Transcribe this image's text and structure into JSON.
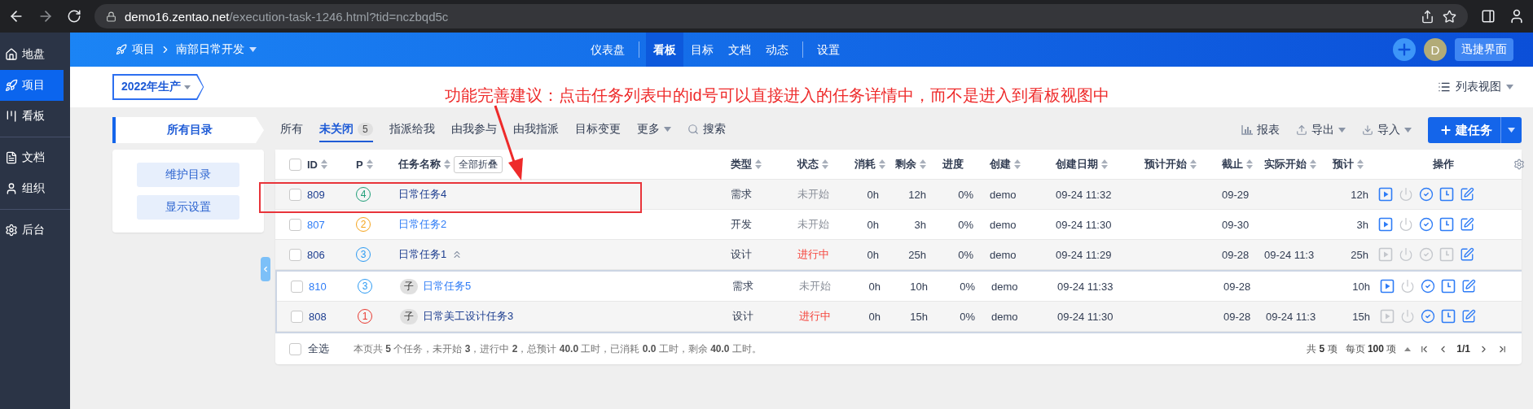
{
  "browser": {
    "domain": "demo16.zentao.net",
    "path": "/execution-task-1246.html?tid=nczbqd5c"
  },
  "sidebar": {
    "groups": [
      [
        {
          "label": "地盘",
          "kind": "home",
          "selected": false
        },
        {
          "label": "项目",
          "kind": "project",
          "selected": true
        },
        {
          "label": "看板",
          "kind": "kanban",
          "selected": false
        }
      ],
      [
        {
          "label": "文档",
          "kind": "doc",
          "selected": false
        },
        {
          "label": "组织",
          "kind": "org",
          "selected": false
        }
      ],
      [
        {
          "label": "后台",
          "kind": "admin",
          "selected": false
        }
      ]
    ]
  },
  "topbar": {
    "breadcrumb": {
      "root": "项目",
      "current": "南部日常开发"
    },
    "nav": [
      [
        {
          "label": "仪表盘",
          "selected": false
        }
      ],
      [
        {
          "label": "看板",
          "selected": true
        },
        {
          "label": "目标",
          "selected": false
        },
        {
          "label": "文档",
          "selected": false
        },
        {
          "label": "动态",
          "selected": false
        }
      ],
      [
        {
          "label": "设置",
          "selected": false
        }
      ]
    ],
    "avatar": "D",
    "quick_button": "迅捷界面"
  },
  "subbar": {
    "execution": "2022年生产",
    "view": "列表视图"
  },
  "annotation": {
    "text": "功能完善建议：点击任务列表中的id号可以直接进入的任务详情中，而不是进入到看板视图中"
  },
  "catalog": {
    "title": "所有目录",
    "buttons": [
      "维护目录",
      "显示设置"
    ]
  },
  "filters": [
    {
      "label": "所有",
      "kind": "tab",
      "selected": false
    },
    {
      "label": "未关闭",
      "kind": "tab",
      "selected": true,
      "count": "5"
    },
    {
      "label": "指派给我",
      "kind": "tab",
      "selected": false
    },
    {
      "label": "由我参与",
      "kind": "tab",
      "selected": false
    },
    {
      "label": "由我指派",
      "kind": "tab",
      "selected": false
    },
    {
      "label": "目标变更",
      "kind": "tab",
      "selected": false
    },
    {
      "label": "更多",
      "kind": "dropdown",
      "selected": false
    },
    {
      "label": "搜索",
      "kind": "search",
      "selected": false
    }
  ],
  "toolbar": [
    {
      "label": "报表",
      "kind": "report"
    },
    {
      "label": "导出",
      "kind": "export"
    },
    {
      "label": "导入",
      "kind": "import"
    }
  ],
  "create_button": "建任务",
  "table": {
    "columns": [
      {
        "label": "ID",
        "sortable": true
      },
      {
        "label": "P",
        "sortable": true
      },
      {
        "label": "任务名称",
        "sortable": true
      },
      {
        "label": "类型",
        "sortable": true
      },
      {
        "label": "状态",
        "sortable": true
      },
      {
        "label": "消耗",
        "sortable": true
      },
      {
        "label": "剩余",
        "sortable": true
      },
      {
        "label": "进度",
        "sortable": false
      },
      {
        "label": "创建",
        "sortable": true
      },
      {
        "label": "创建日期",
        "sortable": true
      },
      {
        "label": "预计开始",
        "sortable": true
      },
      {
        "label": "截止",
        "sortable": true
      },
      {
        "label": "实际开始",
        "sortable": true
      },
      {
        "label": "预计",
        "sortable": true
      },
      {
        "label": "操作",
        "sortable": false
      }
    ],
    "collapse_button": "全部折叠",
    "header_checked": false,
    "rows": [
      {
        "id": "809",
        "checked": false,
        "visited": true,
        "priority": {
          "text": "4",
          "color": "#1e9e78"
        },
        "name": "日常任务4",
        "type": "需求",
        "status": {
          "text": "未开始",
          "kind": "wait"
        },
        "consumed": "0h",
        "left": "12h",
        "progress": "0%",
        "creator": "demo",
        "created": "09-24 11:32",
        "deadline": "09-29",
        "estimate": "12h",
        "actions": [
          {
            "kind": "start",
            "disabled": false
          },
          {
            "kind": "pause",
            "disabled": true
          },
          {
            "kind": "finish",
            "disabled": false
          },
          {
            "kind": "record",
            "disabled": false
          },
          {
            "kind": "edit",
            "disabled": false
          }
        ]
      },
      {
        "id": "807",
        "checked": false,
        "visited": false,
        "priority": {
          "text": "2",
          "color": "#f5a31a"
        },
        "name": "日常任务2",
        "type": "开发",
        "status": {
          "text": "未开始",
          "kind": "wait"
        },
        "consumed": "0h",
        "left": "3h",
        "progress": "0%",
        "creator": "demo",
        "created": "09-24 11:30",
        "deadline": "09-30",
        "estimate": "3h",
        "actions": [
          {
            "kind": "start",
            "disabled": false
          },
          {
            "kind": "pause",
            "disabled": true
          },
          {
            "kind": "finish",
            "disabled": false
          },
          {
            "kind": "record",
            "disabled": false
          },
          {
            "kind": "edit",
            "disabled": false
          }
        ]
      },
      {
        "id": "806",
        "checked": false,
        "visited": true,
        "priority": {
          "text": "3",
          "color": "#2b9af3"
        },
        "name": "日常任务1",
        "expanded": true,
        "type": "设计",
        "status": {
          "text": "进行中",
          "kind": "doing"
        },
        "consumed": "0h",
        "left": "25h",
        "progress": "0%",
        "creator": "demo",
        "created": "09-24 11:29",
        "deadline": "09-28",
        "real_start": "09-24 11:3",
        "estimate": "25h",
        "actions": [
          {
            "kind": "start",
            "disabled": true
          },
          {
            "kind": "pause",
            "disabled": true
          },
          {
            "kind": "finish",
            "disabled": true
          },
          {
            "kind": "record",
            "disabled": true
          },
          {
            "kind": "edit",
            "disabled": false
          }
        ],
        "children": [
          {
            "id": "810",
            "checked": false,
            "visited": false,
            "priority": {
              "text": "3",
              "color": "#2b9af3"
            },
            "badge": "子",
            "name": "日常任务5",
            "type": "需求",
            "status": {
              "text": "未开始",
              "kind": "wait"
            },
            "consumed": "0h",
            "left": "10h",
            "progress": "0%",
            "creator": "demo",
            "created": "09-24 11:33",
            "deadline": "09-28",
            "estimate": "10h",
            "actions": [
              {
                "kind": "start",
                "disabled": false
              },
              {
                "kind": "pause",
                "disabled": true
              },
              {
                "kind": "finish",
                "disabled": false
              },
              {
                "kind": "record",
                "disabled": false
              },
              {
                "kind": "edit",
                "disabled": false
              }
            ]
          },
          {
            "id": "808",
            "checked": false,
            "visited": true,
            "priority": {
              "text": "1",
              "color": "#e8382f"
            },
            "badge": "子",
            "name": "日常美工设计任务3",
            "type": "设计",
            "status": {
              "text": "进行中",
              "kind": "doing"
            },
            "consumed": "0h",
            "left": "15h",
            "progress": "0%",
            "creator": "demo",
            "created": "09-24 11:30",
            "deadline": "09-28",
            "real_start": "09-24 11:3",
            "estimate": "15h",
            "actions": [
              {
                "kind": "start",
                "disabled": true
              },
              {
                "kind": "pause",
                "disabled": true
              },
              {
                "kind": "finish",
                "disabled": false
              },
              {
                "kind": "record",
                "disabled": false
              },
              {
                "kind": "edit",
                "disabled": false
              }
            ]
          }
        ]
      }
    ],
    "footer": {
      "select_all": "全选",
      "select_all_checked": false,
      "summary": "本页共 **5** 个任务，未开始 **3**，进行中 **2**，总预计 **40.0** 工时，已消耗 **0.0** 工时，剩余 **40.0** 工时。",
      "total": "共 **5** 项",
      "per_page": "每页 **100** 项",
      "page": "1/1"
    }
  }
}
